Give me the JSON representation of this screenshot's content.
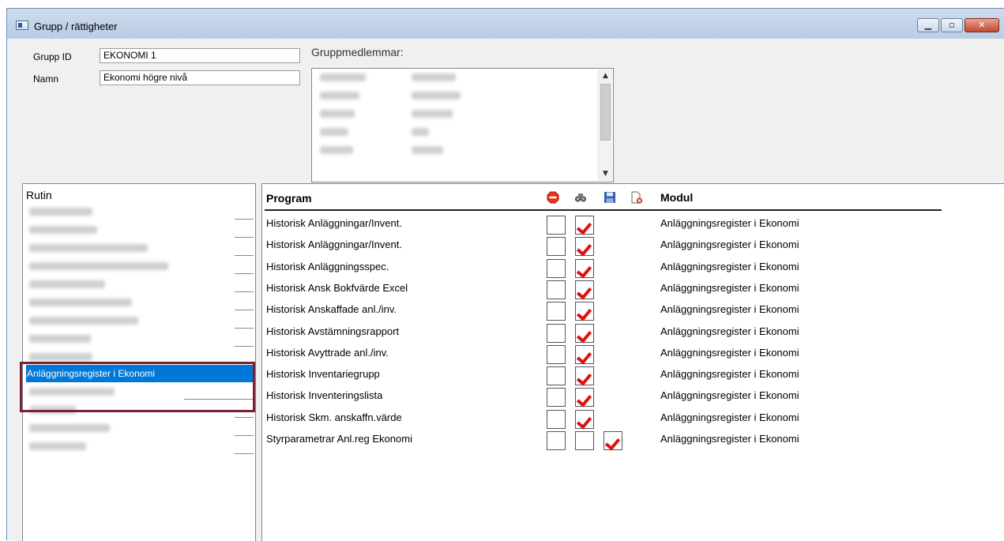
{
  "window": {
    "title": "Grupp / rättigheter"
  },
  "form": {
    "grupp_id_label": "Grupp ID",
    "grupp_id_value": "EKONOMI 1",
    "namn_label": "Namn",
    "namn_value": "Ekonomi högre nivå",
    "members_label": "Gruppmedlemmar:"
  },
  "rutin": {
    "header": "Rutin",
    "selected_label": "Anläggningsregister i Ekonomi"
  },
  "programs": {
    "header_program": "Program",
    "header_modul": "Modul",
    "header_icons": [
      "stop-icon",
      "binoculars-icon",
      "save-icon",
      "delete-document-icon"
    ],
    "rows": [
      {
        "name": "Historisk Anläggningar/Invent.",
        "modul": "Anläggningsregister i Ekonomi",
        "stop": false,
        "view": true,
        "save": null
      },
      {
        "name": "Historisk Anläggningar/Invent.",
        "modul": "Anläggningsregister i Ekonomi",
        "stop": false,
        "view": true,
        "save": null
      },
      {
        "name": "Historisk Anläggningsspec.",
        "modul": "Anläggningsregister i Ekonomi",
        "stop": false,
        "view": true,
        "save": null
      },
      {
        "name": "Historisk Ansk Bokfvärde Excel",
        "modul": "Anläggningsregister i Ekonomi",
        "stop": false,
        "view": true,
        "save": null
      },
      {
        "name": "Historisk Anskaffade anl./inv.",
        "modul": "Anläggningsregister i Ekonomi",
        "stop": false,
        "view": true,
        "save": null
      },
      {
        "name": "Historisk Avstämningsrapport",
        "modul": "Anläggningsregister i Ekonomi",
        "stop": false,
        "view": true,
        "save": null
      },
      {
        "name": "Historisk Avyttrade anl./inv.",
        "modul": "Anläggningsregister i Ekonomi",
        "stop": false,
        "view": true,
        "save": null
      },
      {
        "name": "Historisk Inventariegrupp",
        "modul": "Anläggningsregister i Ekonomi",
        "stop": false,
        "view": true,
        "save": null
      },
      {
        "name": "Historisk Inventeringslista",
        "modul": "Anläggningsregister i Ekonomi",
        "stop": false,
        "view": true,
        "save": null
      },
      {
        "name": "Historisk Skm. anskaffn.värde",
        "modul": "Anläggningsregister i Ekonomi",
        "stop": false,
        "view": true,
        "save": null
      },
      {
        "name": "Styrparametrar Anl.reg Ekonomi",
        "modul": "Anläggningsregister i Ekonomi",
        "stop": false,
        "view": false,
        "save": true
      }
    ]
  },
  "colors": {
    "accent": "#0078d7",
    "check": "#e01010",
    "highlight_border": "#7c2232"
  }
}
